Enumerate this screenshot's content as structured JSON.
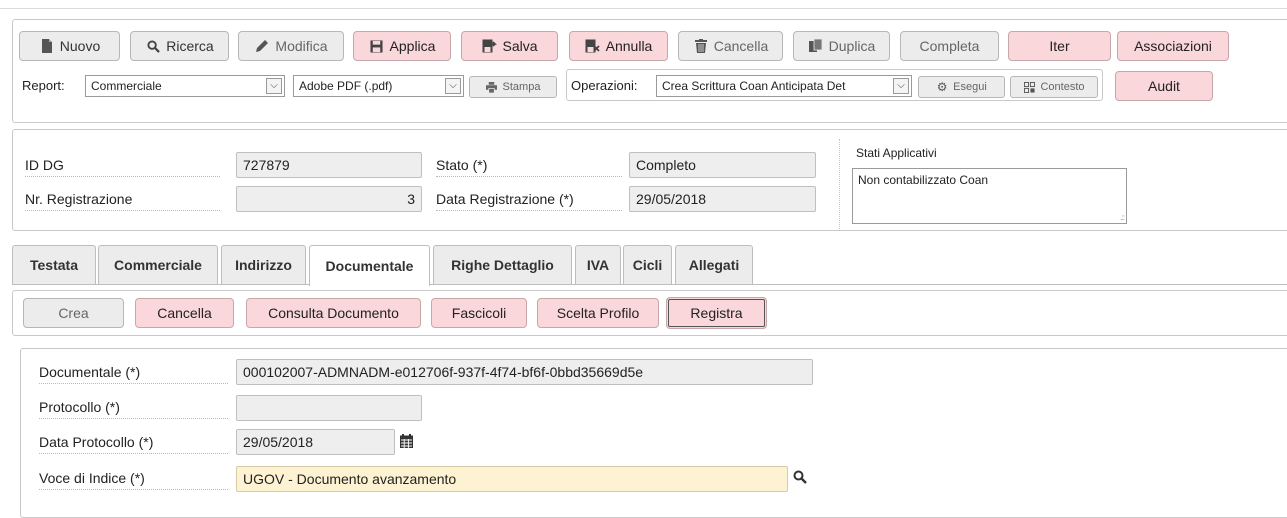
{
  "toolbar": {
    "buttons": {
      "nuovo": "Nuovo",
      "ricerca": "Ricerca",
      "modifica": "Modifica",
      "applica": "Applica",
      "salva": "Salva",
      "annulla": "Annulla",
      "cancella": "Cancella",
      "duplica": "Duplica",
      "completa": "Completa",
      "iter": "Iter",
      "associazioni": "Associazioni",
      "audit": "Audit"
    },
    "report_label": "Report:",
    "report_value": "Commerciale",
    "format_value": "Adobe PDF (.pdf)",
    "stampa": "Stampa",
    "operazioni_label": "Operazioni:",
    "operazioni_value": "Crea Scrittura Coan Anticipata Det",
    "esegui": "Esegui",
    "contesto": "Contesto"
  },
  "header": {
    "id_dg_label": "ID DG",
    "id_dg_value": "727879",
    "nr_reg_label": "Nr. Registrazione",
    "nr_reg_value": "3",
    "stato_label": "Stato (*)",
    "stato_value": "Completo",
    "data_reg_label": "Data Registrazione (*)",
    "data_reg_value": "29/05/2018",
    "stati_title": "Stati Applicativi",
    "stati_value": "Non contabilizzato Coan"
  },
  "tabs": [
    {
      "label": "Testata"
    },
    {
      "label": "Commerciale"
    },
    {
      "label": "Indirizzo"
    },
    {
      "label": "Documentale",
      "active": true
    },
    {
      "label": "Righe Dettaglio"
    },
    {
      "label": "IVA"
    },
    {
      "label": "Cicli"
    },
    {
      "label": "Allegati"
    }
  ],
  "sub_buttons": {
    "crea": "Crea",
    "cancella": "Cancella",
    "consulta": "Consulta Documento",
    "fascicoli": "Fascicoli",
    "scelta_profilo": "Scelta Profilo",
    "registra": "Registra"
  },
  "doc": {
    "documentale_label": "Documentale (*)",
    "documentale_value": "000102007-ADMNADM-e012706f-937f-4f74-bf6f-0bbd35669d5e",
    "protocollo_label": "Protocollo (*)",
    "protocollo_value": "",
    "data_protocollo_label": "Data Protocollo (*)",
    "data_protocollo_value": "29/05/2018",
    "voce_label": "Voce di Indice (*)",
    "voce_value": "UGOV - Documento avanzamento"
  },
  "icons": {
    "nuovo": "file-icon",
    "ricerca": "search-icon",
    "modifica": "pencil-icon",
    "applica": "save-icon",
    "salva": "save-exit-icon",
    "annulla": "cancel-icon",
    "cancella": "trash-icon",
    "duplica": "copy-icon",
    "calendar": "calendar-icon"
  },
  "colors": {
    "pink_button": "#fad7da",
    "grey_button": "#ececec",
    "readonly_field": "#eeeeee",
    "required_field": "#fdf3d2"
  }
}
